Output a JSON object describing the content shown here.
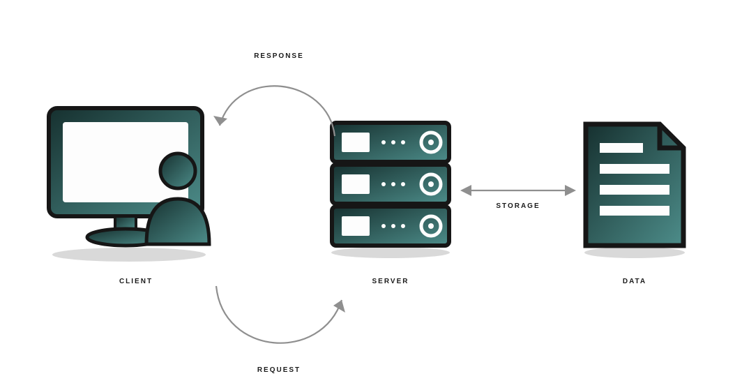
{
  "diagram": {
    "nodes": {
      "client": {
        "label": "CLIENT"
      },
      "server": {
        "label": "SERVER"
      },
      "data": {
        "label": "DATA"
      }
    },
    "edges": {
      "response": {
        "label": "RESPONSE"
      },
      "request": {
        "label": "REQUEST"
      },
      "storage": {
        "label": "STORAGE"
      }
    },
    "colors": {
      "fill_dark": "#1d3d3d",
      "fill_light": "#3e6e6e",
      "stroke": "#161616",
      "screen": "#fdfdfd",
      "arrow": "#8f8f8f"
    }
  }
}
